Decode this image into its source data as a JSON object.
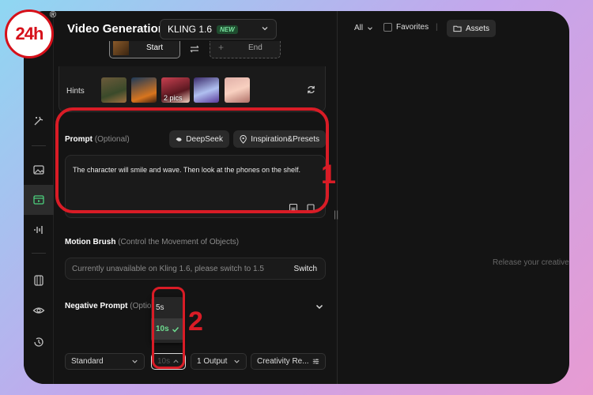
{
  "logo": {
    "text": "24h",
    "mark": "®"
  },
  "header": {
    "title": "Video Generation",
    "model": {
      "value": "KLING 1.6",
      "badge": "NEW"
    }
  },
  "frames": {
    "start_label": "Start",
    "end_label": "End"
  },
  "hints": {
    "label": "Hints",
    "pics_label": "2 pics"
  },
  "prompt": {
    "label": "Prompt",
    "optional": "(Optional)",
    "deepseek_label": "DeepSeek",
    "inspiration_label": "Inspiration&Presets",
    "text": "The character will smile and wave. Then look at the phones on the shelf."
  },
  "motion_brush": {
    "label": "Motion Brush",
    "sub": "(Control the Movement of Objects)",
    "notice": "Currently unavailable on Kling 1.6, please switch to 1.5",
    "switch_label": "Switch"
  },
  "negative_prompt": {
    "label": "Negative Prompt",
    "optional": "(Optio"
  },
  "bottom_bar": {
    "mode": "Standard",
    "duration": "10s",
    "outputs": "1 Output",
    "creativity": "Creativity Re..."
  },
  "duration_dropdown": {
    "options": [
      "5s",
      "10s"
    ],
    "selected": "10s"
  },
  "right_panel": {
    "filter": "All",
    "favorites": "Favorites",
    "separator": "|",
    "assets": "Assets",
    "empty_text": "Release your creative"
  },
  "annotations": {
    "one": "1",
    "two": "2"
  },
  "colors": {
    "accent_green": "#4ccf7c",
    "annotation_red": "#d91c26",
    "panel_bg": "#141414"
  }
}
